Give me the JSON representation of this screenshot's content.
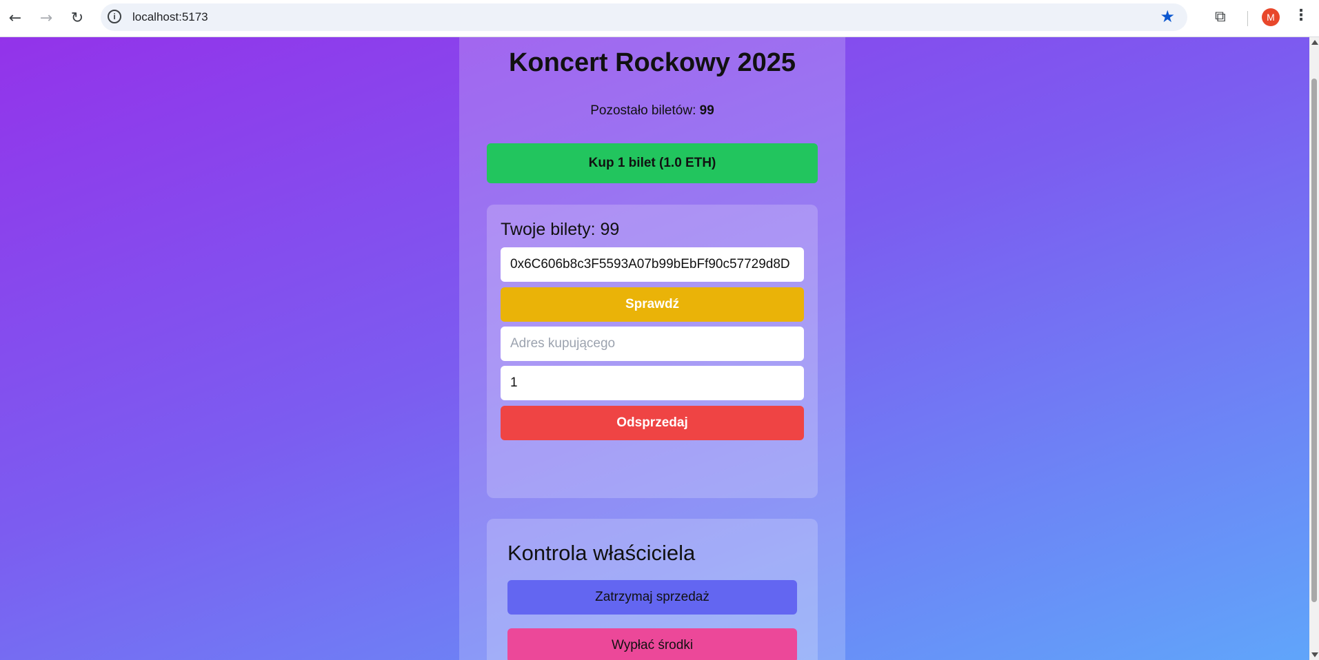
{
  "browser": {
    "url": "localhost:5173",
    "avatar_letter": "M",
    "icons": {
      "back": "back-arrow-icon",
      "forward": "forward-arrow-icon",
      "reload": "reload-icon",
      "info": "site-info-icon",
      "bookmark": "star-icon",
      "extensions": "puzzle-icon",
      "menu": "kebab-menu-icon"
    }
  },
  "page": {
    "title": "Koncert Rockowy 2025",
    "remaining_label": "Pozostało biletów:",
    "remaining_value": "99",
    "buy_button": "Kup 1 bilet (1.0 ETH)"
  },
  "tickets_card": {
    "heading": "Twoje bilety: 99",
    "address_value": "0x6C606b8c3F5593A07b99bEbFf90c57729d8D",
    "check_button": "Sprawdź",
    "buyer_placeholder": "Adres kupującego",
    "quantity_value": "1",
    "resell_button": "Odsprzedaj"
  },
  "owner_card": {
    "heading": "Kontrola właściciela",
    "stop_button": "Zatrzymaj sprzedaż",
    "withdraw_button": "Wypłać środki"
  },
  "colors": {
    "buy": "#22c55e",
    "check": "#eab308",
    "resell": "#ef4444",
    "stop": "#6366f1",
    "withdraw": "#ec4899"
  }
}
